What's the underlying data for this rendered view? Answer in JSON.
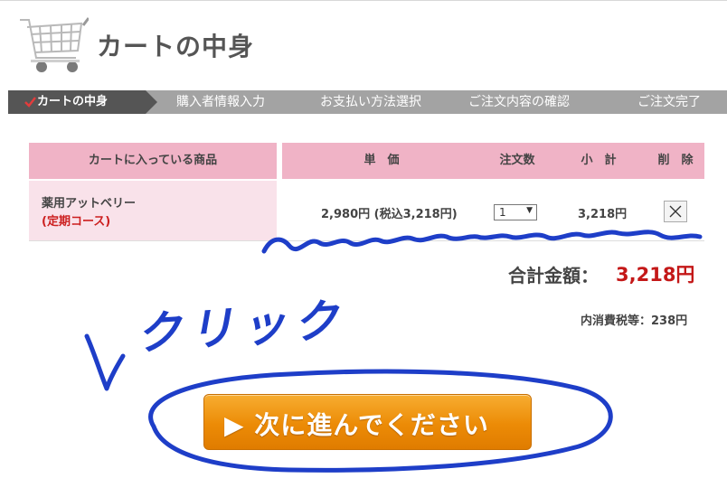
{
  "header": {
    "title": "カートの中身",
    "logo_icon": "shopping-cart-icon"
  },
  "steps": [
    {
      "label": "カートの中身",
      "active": true
    },
    {
      "label": "購入者情報入力",
      "active": false
    },
    {
      "label": "お支払い方法選択",
      "active": false
    },
    {
      "label": "ご注文内容の確認",
      "active": false
    },
    {
      "label": "ご注文完了",
      "active": false
    }
  ],
  "table": {
    "headers": {
      "product": "カートに入っている商品",
      "unit_price": "単　価",
      "quantity": "注文数",
      "subtotal": "小　計",
      "delete": "削　除"
    },
    "rows": [
      {
        "product_name": "薬用アットベリー",
        "course": "(定期コース)",
        "price": "2,980円 (税込3,218円)",
        "quantity": "1",
        "subtotal": "3,218円",
        "delete_icon": "close-icon"
      }
    ]
  },
  "totals": {
    "label": "合計金額：",
    "value": "3,218円",
    "tax": "内消費税等：238円"
  },
  "next_button": {
    "label": "▶ 次に進んでください"
  },
  "annotation": {
    "text": "クリック"
  },
  "colors": {
    "step_bar": "#a3a3a3",
    "step_active": "#555555",
    "table_header": "#f0b3c6",
    "product_bg": "#f9e2ea",
    "accent_red": "#c41818",
    "button_orange": "#ec8b06",
    "annotation_blue": "#1e3ec8"
  }
}
